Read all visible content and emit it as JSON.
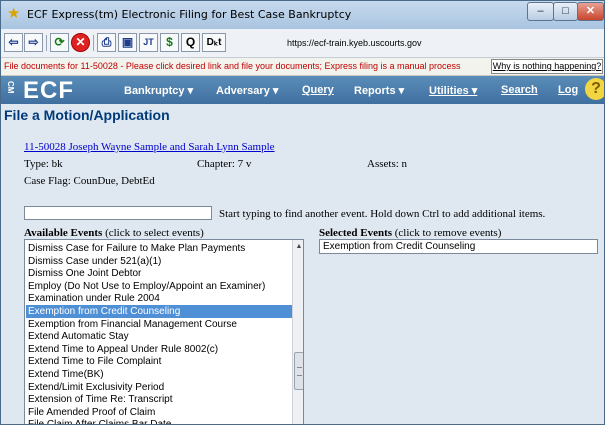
{
  "window": {
    "title": "ECF Express(tm) Electronic Filing for Best Case Bankruptcy",
    "minimize": "–",
    "maximize": "□",
    "close": "✕"
  },
  "toolbar": {
    "back": "⇦",
    "forward": "⇨",
    "refresh": "⟳",
    "stop": "✕",
    "print": "⎙",
    "save": "▣",
    "tool_jt": "JT",
    "money": "$",
    "query": "Q",
    "docket": "Dₖt",
    "url": "https://ecf-train.kyeb.uscourts.gov"
  },
  "info": {
    "message": "File documents for 11-50028 - Please click desired link and file your documents; Express filing is a manual process",
    "why_button": "Why is nothing happening?"
  },
  "nav": {
    "logo": "ECF",
    "logo_side": "CM",
    "items": [
      "Bankruptcy ▾",
      "Adversary ▾",
      "Query",
      "Reports ▾",
      "Utilities ▾",
      "Search",
      "Log"
    ],
    "help": "?"
  },
  "page": {
    "title": "File a Motion/Application",
    "case_link": "11-50028 Joseph Wayne Sample and Sarah Lynn Sample",
    "type": "Type: bk",
    "chapter": "Chapter: 7 v",
    "assets": "Assets: n",
    "case_flag": "Case Flag: CounDue, DebtEd",
    "search_hint": "Start typing to find another event. Hold down Ctrl to add additional items.",
    "available_label": "Available Events",
    "available_note": "(click to select events)",
    "selected_label": "Selected Events",
    "selected_note": "(click to remove events)"
  },
  "available_events": [
    "Dismiss Case for Failure to Make Plan Payments",
    "Dismiss Case under 521(a)(1)",
    "Dismiss One Joint Debtor",
    "Employ (Do Not Use to Employ/Appoint an Examiner)",
    "Examination under Rule 2004",
    "Exemption from Credit Counseling",
    "Exemption from Financial Management Course",
    "Extend Automatic Stay",
    "Extend Time to Appeal Under Rule 8002(c)",
    "Extend Time to File Complaint",
    "Extend Time(BK)",
    "Extend/Limit Exclusivity Period",
    "Extension of Time Re: Transcript",
    "File Amended Proof of Claim",
    "File Claim After Claims Bar Date"
  ],
  "selected_index": 5,
  "selected_events": [
    "Exemption from Credit Counseling"
  ]
}
